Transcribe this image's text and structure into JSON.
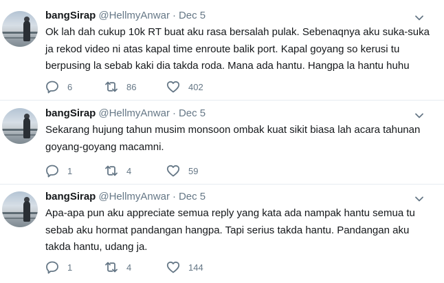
{
  "tweets": [
    {
      "name": "bangSirap",
      "handle": "@HellmyAnwar",
      "separator": "·",
      "date": "Dec 5",
      "lines": [
        "Ok lah dah cukup 10k RT buat aku rasa bersalah pulak. Sebenaqnya aku suka-suka",
        "ja rekod video ni atas kapal time enroute balik port. Kapal goyang so kerusi tu",
        "berpusing la sebab kaki dia takda roda. Mana ada hantu. Hangpa la hantu huhu"
      ],
      "replies": "6",
      "retweets": "86",
      "likes": "402"
    },
    {
      "name": "bangSirap",
      "handle": "@HellmyAnwar",
      "separator": "·",
      "date": "Dec 5",
      "lines": [
        "Sekarang hujung tahun musim monsoon ombak kuat sikit biasa lah acara tahunan",
        "goyang-goyang macamni."
      ],
      "replies": "1",
      "retweets": "4",
      "likes": "59"
    },
    {
      "name": "bangSirap",
      "handle": "@HellmyAnwar",
      "separator": "·",
      "date": "Dec 5",
      "lines": [
        "Apa-apa pun aku appreciate semua reply yang kata ada nampak hantu semua tu",
        "sebab aku hormat pandangan hangpa. Tapi serius takda hantu. Pandangan aku",
        "takda hantu, udang ja."
      ],
      "replies": "1",
      "retweets": "4",
      "likes": "144"
    }
  ],
  "icons": {
    "reply": "reply-icon",
    "retweet": "retweet-icon",
    "like": "heart-icon",
    "menu": "chevron-down-icon"
  },
  "colors": {
    "text": "#14171a",
    "muted": "#657786",
    "divider": "#e6ecf0"
  }
}
